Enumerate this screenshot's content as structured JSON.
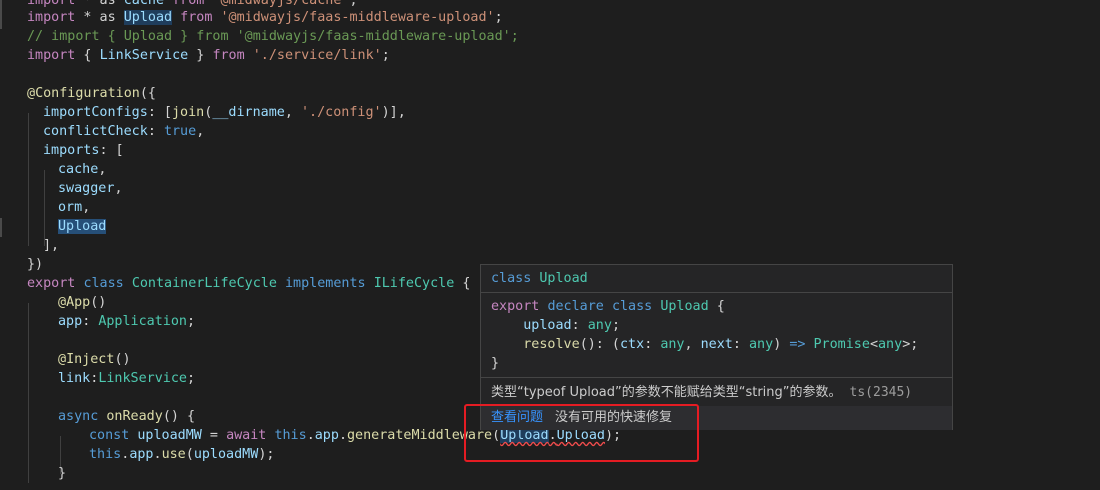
{
  "code": {
    "l1": {
      "a": "import",
      "b": " * as ",
      "c": "cache",
      "d": " from ",
      "e": "'@midwayjs/cache'",
      "f": ";"
    },
    "l2": {
      "a": "import",
      "b": " * as ",
      "c": "Upload",
      "d": " from ",
      "e": "'@midwayjs/faas-middleware-upload'",
      "f": ";"
    },
    "l3": {
      "a": "// import { Upload } from '@midwayjs/faas-middleware-upload';"
    },
    "l4": {
      "a": "import",
      "b": " { ",
      "c": "LinkService",
      "d": " } ",
      "e": "from",
      "f": " ",
      "g": "'./service/link'",
      "h": ";"
    },
    "l6": {
      "a": "@",
      "b": "Configuration",
      "c": "({"
    },
    "l7": {
      "a": "importConfigs",
      "b": ": [",
      "c": "join",
      "d": "(",
      "e": "__dirname",
      "f": ", ",
      "g": "'./config'",
      "h": ")],"
    },
    "l8": {
      "a": "conflictCheck",
      "b": ": ",
      "c": "true",
      "d": ","
    },
    "l9": {
      "a": "imports",
      "b": ": ["
    },
    "l10": {
      "a": "cache",
      "b": ","
    },
    "l11": {
      "a": "swagger",
      "b": ","
    },
    "l12": {
      "a": "orm",
      "b": ","
    },
    "l13": {
      "a": "Upload"
    },
    "l14": {
      "a": "],"
    },
    "l15": {
      "a": "})"
    },
    "l16": {
      "a": "export",
      "b": " ",
      "c": "class",
      "d": " ",
      "e": "ContainerLifeCycle",
      "f": " ",
      "g": "implements",
      "h": " ",
      "i": "ILifeCycle",
      "j": " {"
    },
    "l17": {
      "a": "@",
      "b": "App",
      "c": "()"
    },
    "l18": {
      "a": "app",
      "b": ": ",
      "c": "Application",
      "d": ";"
    },
    "l20": {
      "a": "@",
      "b": "Inject",
      "c": "()"
    },
    "l21": {
      "a": "link",
      "b": ":",
      "c": "LinkService",
      "d": ";"
    },
    "l23": {
      "a": "async",
      "b": " ",
      "c": "onReady",
      "d": "() {"
    },
    "l24": {
      "a": "const",
      "b": " ",
      "c": "uploadMW",
      "d": " = ",
      "e": "await",
      "f": " ",
      "g": "this",
      "h": ".",
      "i": "app",
      "j": ".",
      "k": "generateMiddleware",
      "l": "(",
      "m": "Upload",
      "n": ".",
      "o": "Upload",
      "p": ");"
    },
    "l25": {
      "a": "this",
      "b": ".",
      "c": "app",
      "d": ".",
      "e": "use",
      "f": "(",
      "g": "uploadMW",
      "h": ");"
    },
    "l26": {
      "a": "}"
    }
  },
  "hover": {
    "title": {
      "a": "class",
      "b": " ",
      "c": "Upload"
    },
    "sig1": {
      "a": "export",
      "b": " ",
      "c": "declare",
      "d": " ",
      "e": "class",
      "f": " ",
      "g": "Upload",
      "h": " {"
    },
    "sig2": {
      "a": "    upload",
      "b": ": ",
      "c": "any",
      "d": ";"
    },
    "sig3": {
      "a": "    resolve",
      "b": "(): (",
      "c": "ctx",
      "d": ": ",
      "e": "any",
      "f": ", ",
      "g": "next",
      "h": ": ",
      "i": "any",
      "j": ") ",
      "k": "=>",
      "l": " ",
      "m": "Promise",
      "n": "<",
      "o": "any",
      "p": ">;"
    },
    "sig4": {
      "a": "}"
    },
    "message": "类型“typeof Upload”的参数不能赋给类型“string”的参数。",
    "error_code": "ts(2345)",
    "view_problem": "查看问题",
    "no_quick_fix": "没有可用的快速修复"
  },
  "colors": {
    "error_box": "#e51c23",
    "link": "#3794ff"
  }
}
